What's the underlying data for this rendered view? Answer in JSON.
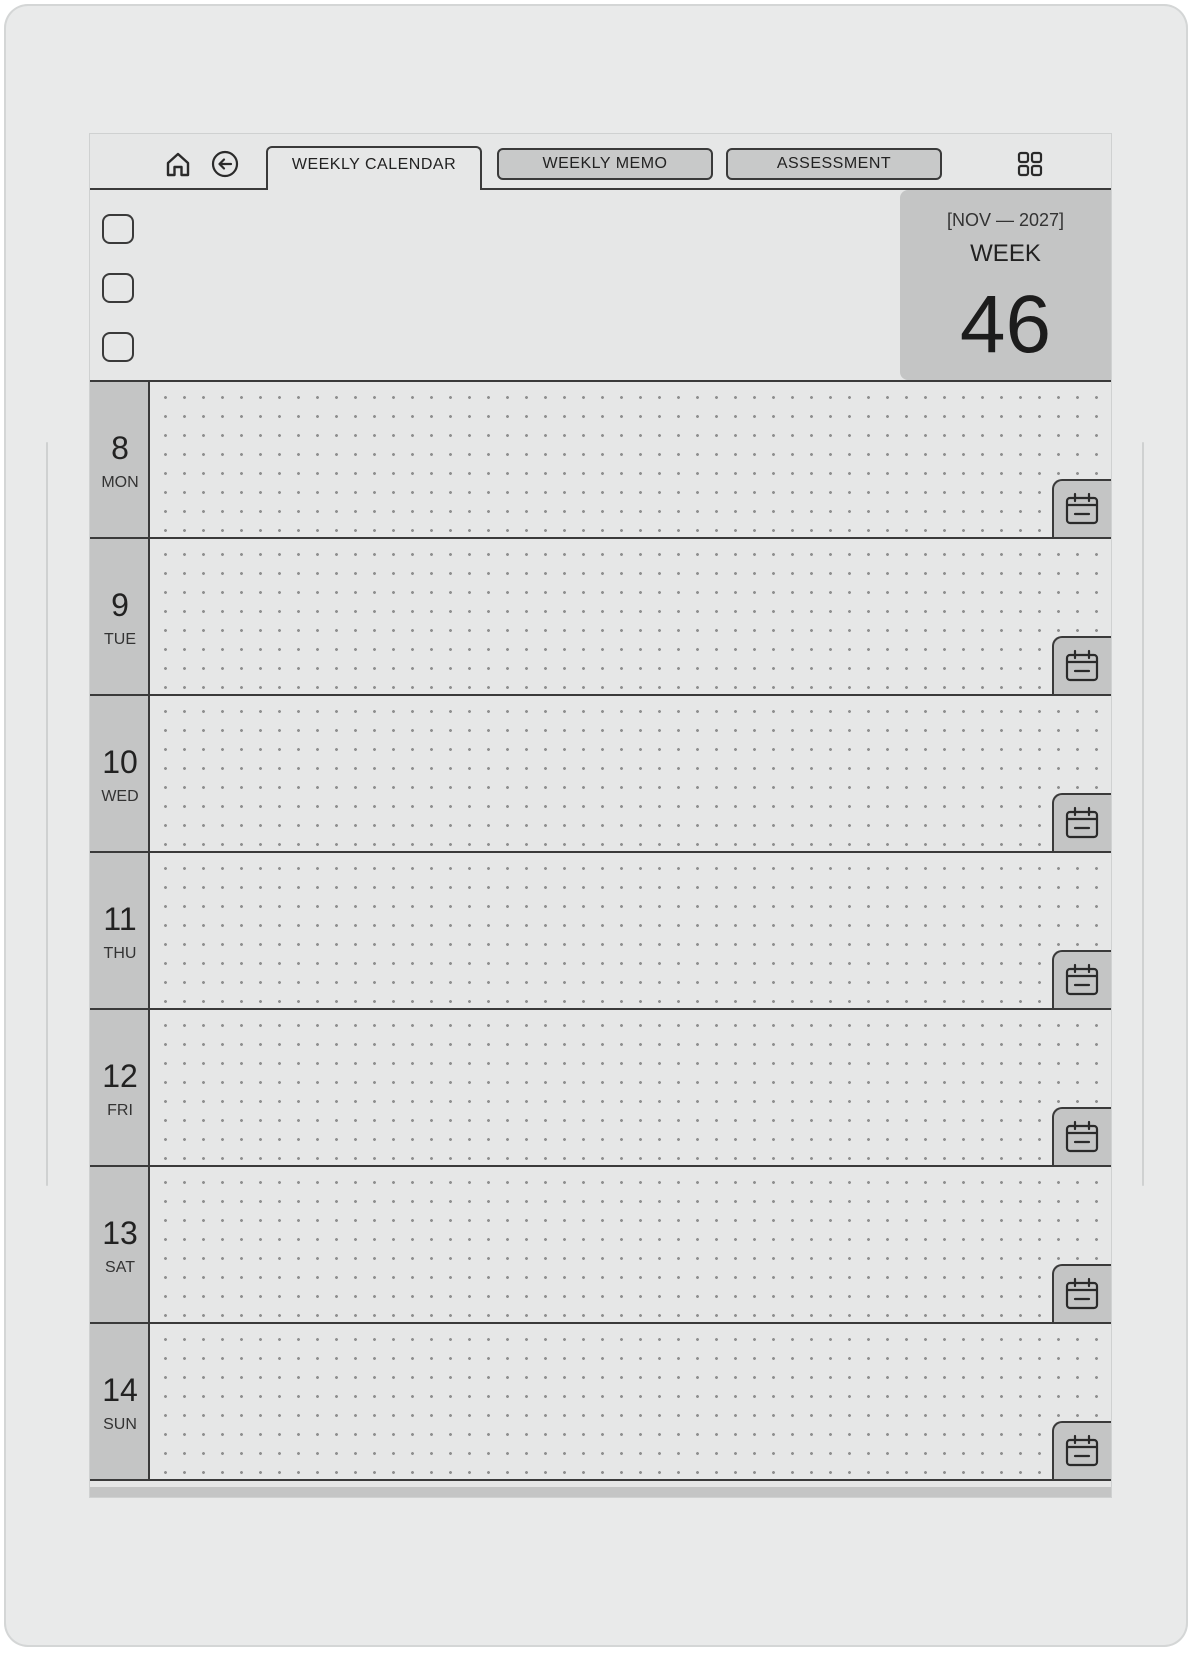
{
  "nav": {
    "home_icon": "home-icon",
    "back_icon": "back-arrow-icon",
    "grid_icon": "grid-icon",
    "tabs": [
      {
        "label": "WEEKLY CALENDAR",
        "active": true
      },
      {
        "label": "WEEKLY MEMO",
        "active": false
      },
      {
        "label": "ASSESSMENT",
        "active": false
      }
    ]
  },
  "header": {
    "checkboxes": [
      false,
      false,
      false
    ],
    "week_range": "[NOV — 2027]",
    "week_label": "WEEK",
    "week_number": "46"
  },
  "days": [
    {
      "num": "8",
      "name": "MON"
    },
    {
      "num": "9",
      "name": "TUE"
    },
    {
      "num": "10",
      "name": "WED"
    },
    {
      "num": "11",
      "name": "THU"
    },
    {
      "num": "12",
      "name": "FRI"
    },
    {
      "num": "13",
      "name": "SAT"
    },
    {
      "num": "14",
      "name": "SUN"
    }
  ],
  "colors": {
    "frame": "#e9eaea",
    "screen": "#e6e7e7",
    "accent_gray": "#c4c5c5",
    "line": "#3a3a3a",
    "dot": "#8f9090"
  }
}
